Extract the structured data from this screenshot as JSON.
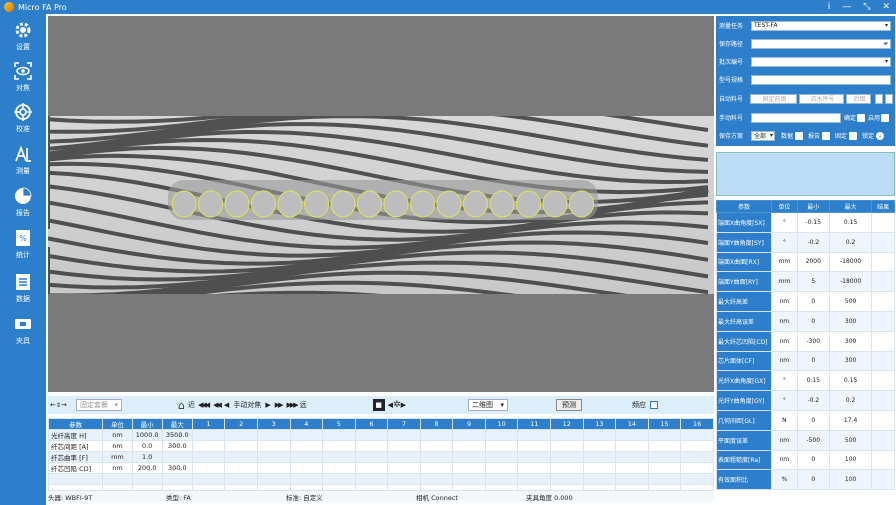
{
  "app": {
    "title": "Micro FA Pro"
  },
  "window_buttons": [
    "i",
    "—",
    "⤡",
    "✕"
  ],
  "sidebar": {
    "items": [
      {
        "label": "设置",
        "icon": "gear-icon"
      },
      {
        "label": "对焦",
        "icon": "focus-eye-icon"
      },
      {
        "label": "校准",
        "icon": "crosshair-icon"
      },
      {
        "label": "测量",
        "icon": "measure-icon"
      },
      {
        "label": "报告",
        "icon": "pie-chart-icon"
      },
      {
        "label": "统计",
        "icon": "percent-document-icon"
      },
      {
        "label": "数据",
        "icon": "document-list-icon"
      },
      {
        "label": "夹具",
        "icon": "fixture-icon"
      }
    ]
  },
  "toolbar": {
    "fixture_combo": "固定套餐",
    "nav_left": "近",
    "manual_focus": "手动对焦",
    "nav_right": "远",
    "view_combo": "二维图",
    "measure_button": "预测",
    "fringe_label": "频应"
  },
  "bottom_table": {
    "headers": [
      "参数",
      "单位",
      "最小",
      "最大",
      "1",
      "2",
      "3",
      "4",
      "5",
      "6",
      "7",
      "8",
      "9",
      "10",
      "11",
      "12",
      "13",
      "14",
      "15",
      "16"
    ],
    "rows": [
      [
        "光纤高度 H]",
        "nm",
        "1000.0",
        "3500.0"
      ],
      [
        "纤芯间距 [A]",
        "nm",
        "0.0",
        "300.0"
      ],
      [
        "纤芯曲率 [F]",
        "mm",
        "1.0",
        ""
      ],
      [
        "纤芯凹陷 CD]",
        "nm",
        "200.0",
        "300.0"
      ]
    ]
  },
  "status": {
    "model": "头器: WBFI-9T",
    "type": "类型: FA",
    "mark": "标准: 自定义",
    "camera": "相机 Connect",
    "angle": "夹具角度 0.000"
  },
  "form": {
    "task_label": "测量任务",
    "task_value": "TEST-FA",
    "save_path_label": "保存路径",
    "batch_label": "批次编号",
    "spec_label": "型号规格",
    "auto_label": "自动料号",
    "auto_fields": [
      "固定前缀",
      "流水序号",
      "后缀"
    ],
    "manual_label": "手动料号",
    "confirm_label": "确定",
    "auto_check_label": "启用",
    "save_mode_label": "保存方案",
    "save_mode_value": "全部",
    "data_label": "数据",
    "report_label": "报告",
    "fixed_label": "固定",
    "lock_label": "锁定"
  },
  "result_table": {
    "headers": [
      "参数",
      "单位",
      "最小",
      "最大",
      "结果"
    ],
    "rows": [
      [
        "端面X曲角度[SX]",
        "°",
        "-0.15",
        "0.15",
        ""
      ],
      [
        "端面Y曲角度[SY]",
        "°",
        "-0.2",
        "0.2",
        ""
      ],
      [
        "端面X曲面[RX]",
        "mm",
        "2000",
        "-18000",
        ""
      ],
      [
        "端面Y曲面[RY]",
        "mm",
        "5",
        "-18000",
        ""
      ],
      [
        "最大纤高差",
        "nm",
        "0",
        "500",
        ""
      ],
      [
        "最大纤高误差",
        "nm",
        "0",
        "300",
        ""
      ],
      [
        "最大纤芯凹陷[CD]",
        "nm",
        "-300",
        "300",
        ""
      ],
      [
        "芯片面体[CF]",
        "nm",
        "0",
        "300",
        ""
      ],
      [
        "光纤X曲角度[GX]",
        "°",
        "0.15",
        "0.15",
        ""
      ],
      [
        "光纤Y曲角度[GY]",
        "°",
        "-0.2",
        "0.2",
        ""
      ],
      [
        "几何间距[GL]",
        "N",
        "0",
        "17.4",
        ""
      ],
      [
        "平面度误差",
        "nm",
        "-500",
        "500",
        ""
      ],
      [
        "表面粗糙度[Ra]",
        "nm",
        "0",
        "100",
        ""
      ],
      [
        "有效面积比",
        "%",
        "0",
        "100",
        ""
      ]
    ]
  }
}
